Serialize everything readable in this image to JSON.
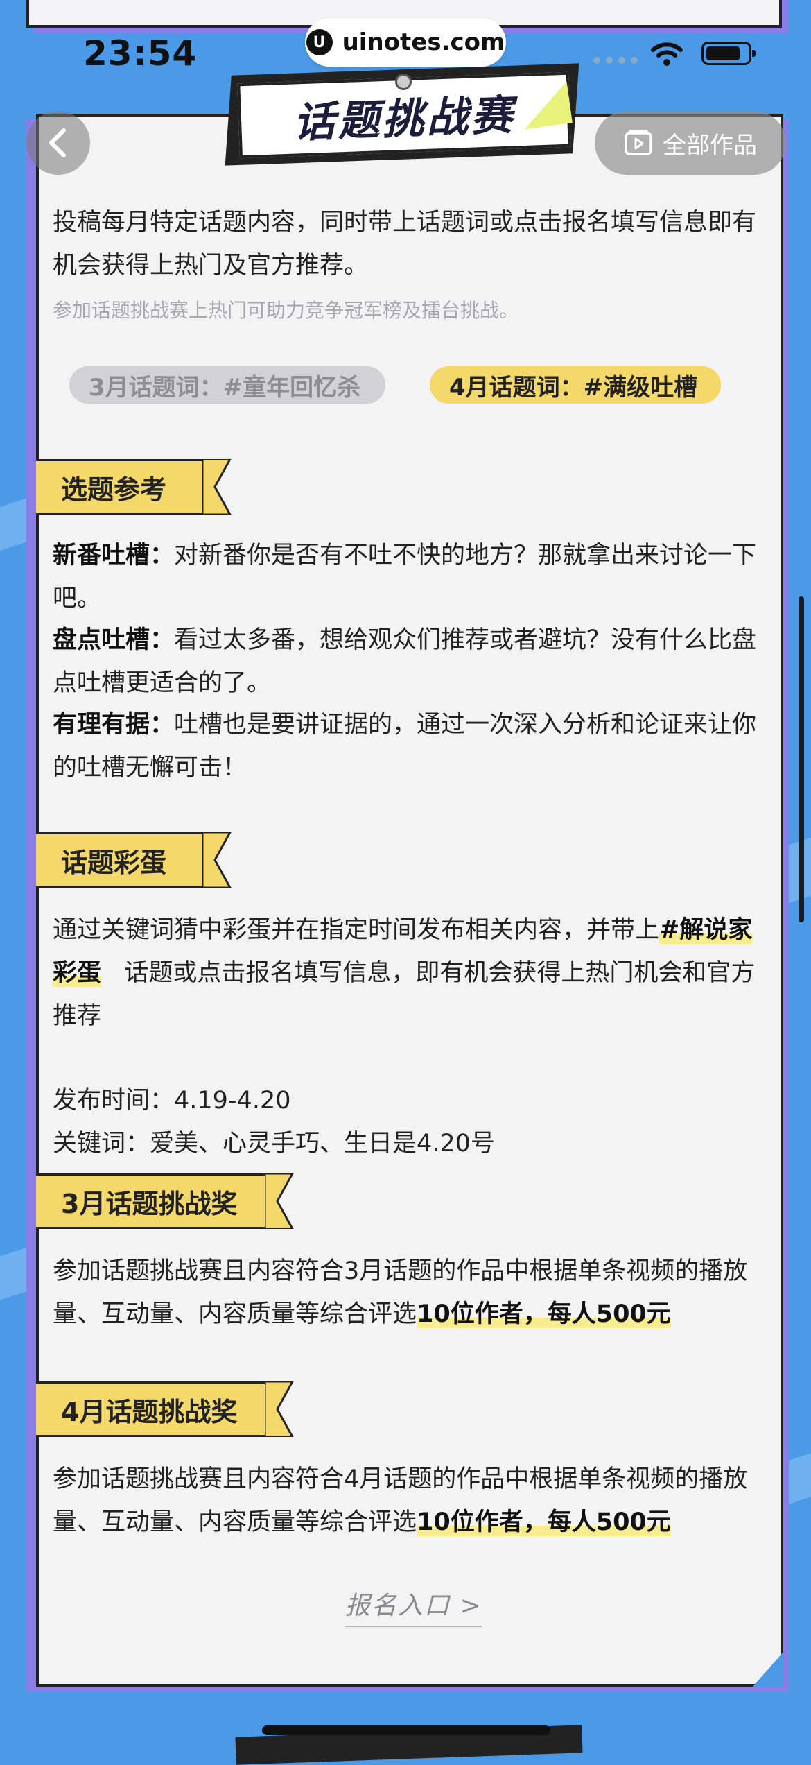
{
  "status_bar": {
    "time": "23:54",
    "watermark": "uinotes.com",
    "watermark_logo": "U"
  },
  "header": {
    "title": "话题挑战赛",
    "back_icon": "chevron-left-icon",
    "all_works_icon": "video-play-icon",
    "all_works_label": "全部作品"
  },
  "intro": {
    "text": "投稿每月特定话题内容，同时带上话题词或点击报名填写信息即有机会获得上热门及官方推荐。",
    "note": "参加话题挑战赛上热门可助力竞争冠军榜及擂台挑战。"
  },
  "topic_tags": [
    {
      "label": "3月话题词：#童年回忆杀",
      "state": "inactive"
    },
    {
      "label": "4月话题词：#满级吐槽",
      "state": "active"
    }
  ],
  "sections": {
    "reference": {
      "title": "选题参考",
      "items": [
        {
          "key": "新番吐槽：",
          "text": "对新番你是否有不吐不快的地方？那就拿出来讨论一下吧。"
        },
        {
          "key": "盘点吐槽：",
          "text": "看过太多番，想给观众们推荐或者避坑？没有什么比盘点吐槽更适合的了。"
        },
        {
          "key": "有理有据：",
          "text": "吐槽也是要讲证据的，通过一次深入分析和论证来让你的吐槽无懈可击！"
        }
      ]
    },
    "easter_egg": {
      "title": "话题彩蛋",
      "line1": "通过关键词猜中彩蛋并在指定时间发布相关内容，并带上",
      "hashtag": "#解说家彩蛋",
      "line2": "话题或点击报名填写信息，即有机会获得上热门机会和官方推荐",
      "publish_time": "发布时间：4.19-4.20",
      "keywords": "关键词：爱美、心灵手巧、生日是4.20号"
    },
    "march_award": {
      "title": "3月话题挑战奖",
      "text": "参加话题挑战赛且内容符合3月话题的作品中根据单条视频的播放量、互动量、内容质量等综合评选",
      "highlight": "10位作者，每人500元"
    },
    "april_award": {
      "title": "4月话题挑战奖",
      "text": "参加话题挑战赛且内容符合4月话题的作品中根据单条视频的播放量、互动量、内容质量等综合评选",
      "highlight": "10位作者，每人500元"
    }
  },
  "signup": {
    "label": "报名入口 >"
  },
  "colors": {
    "page_bg": "#4a9ae8",
    "card_bg": "#f3f3f4",
    "accent_yellow": "#f4d86a",
    "shadow_purple": "#8a7ee6"
  }
}
